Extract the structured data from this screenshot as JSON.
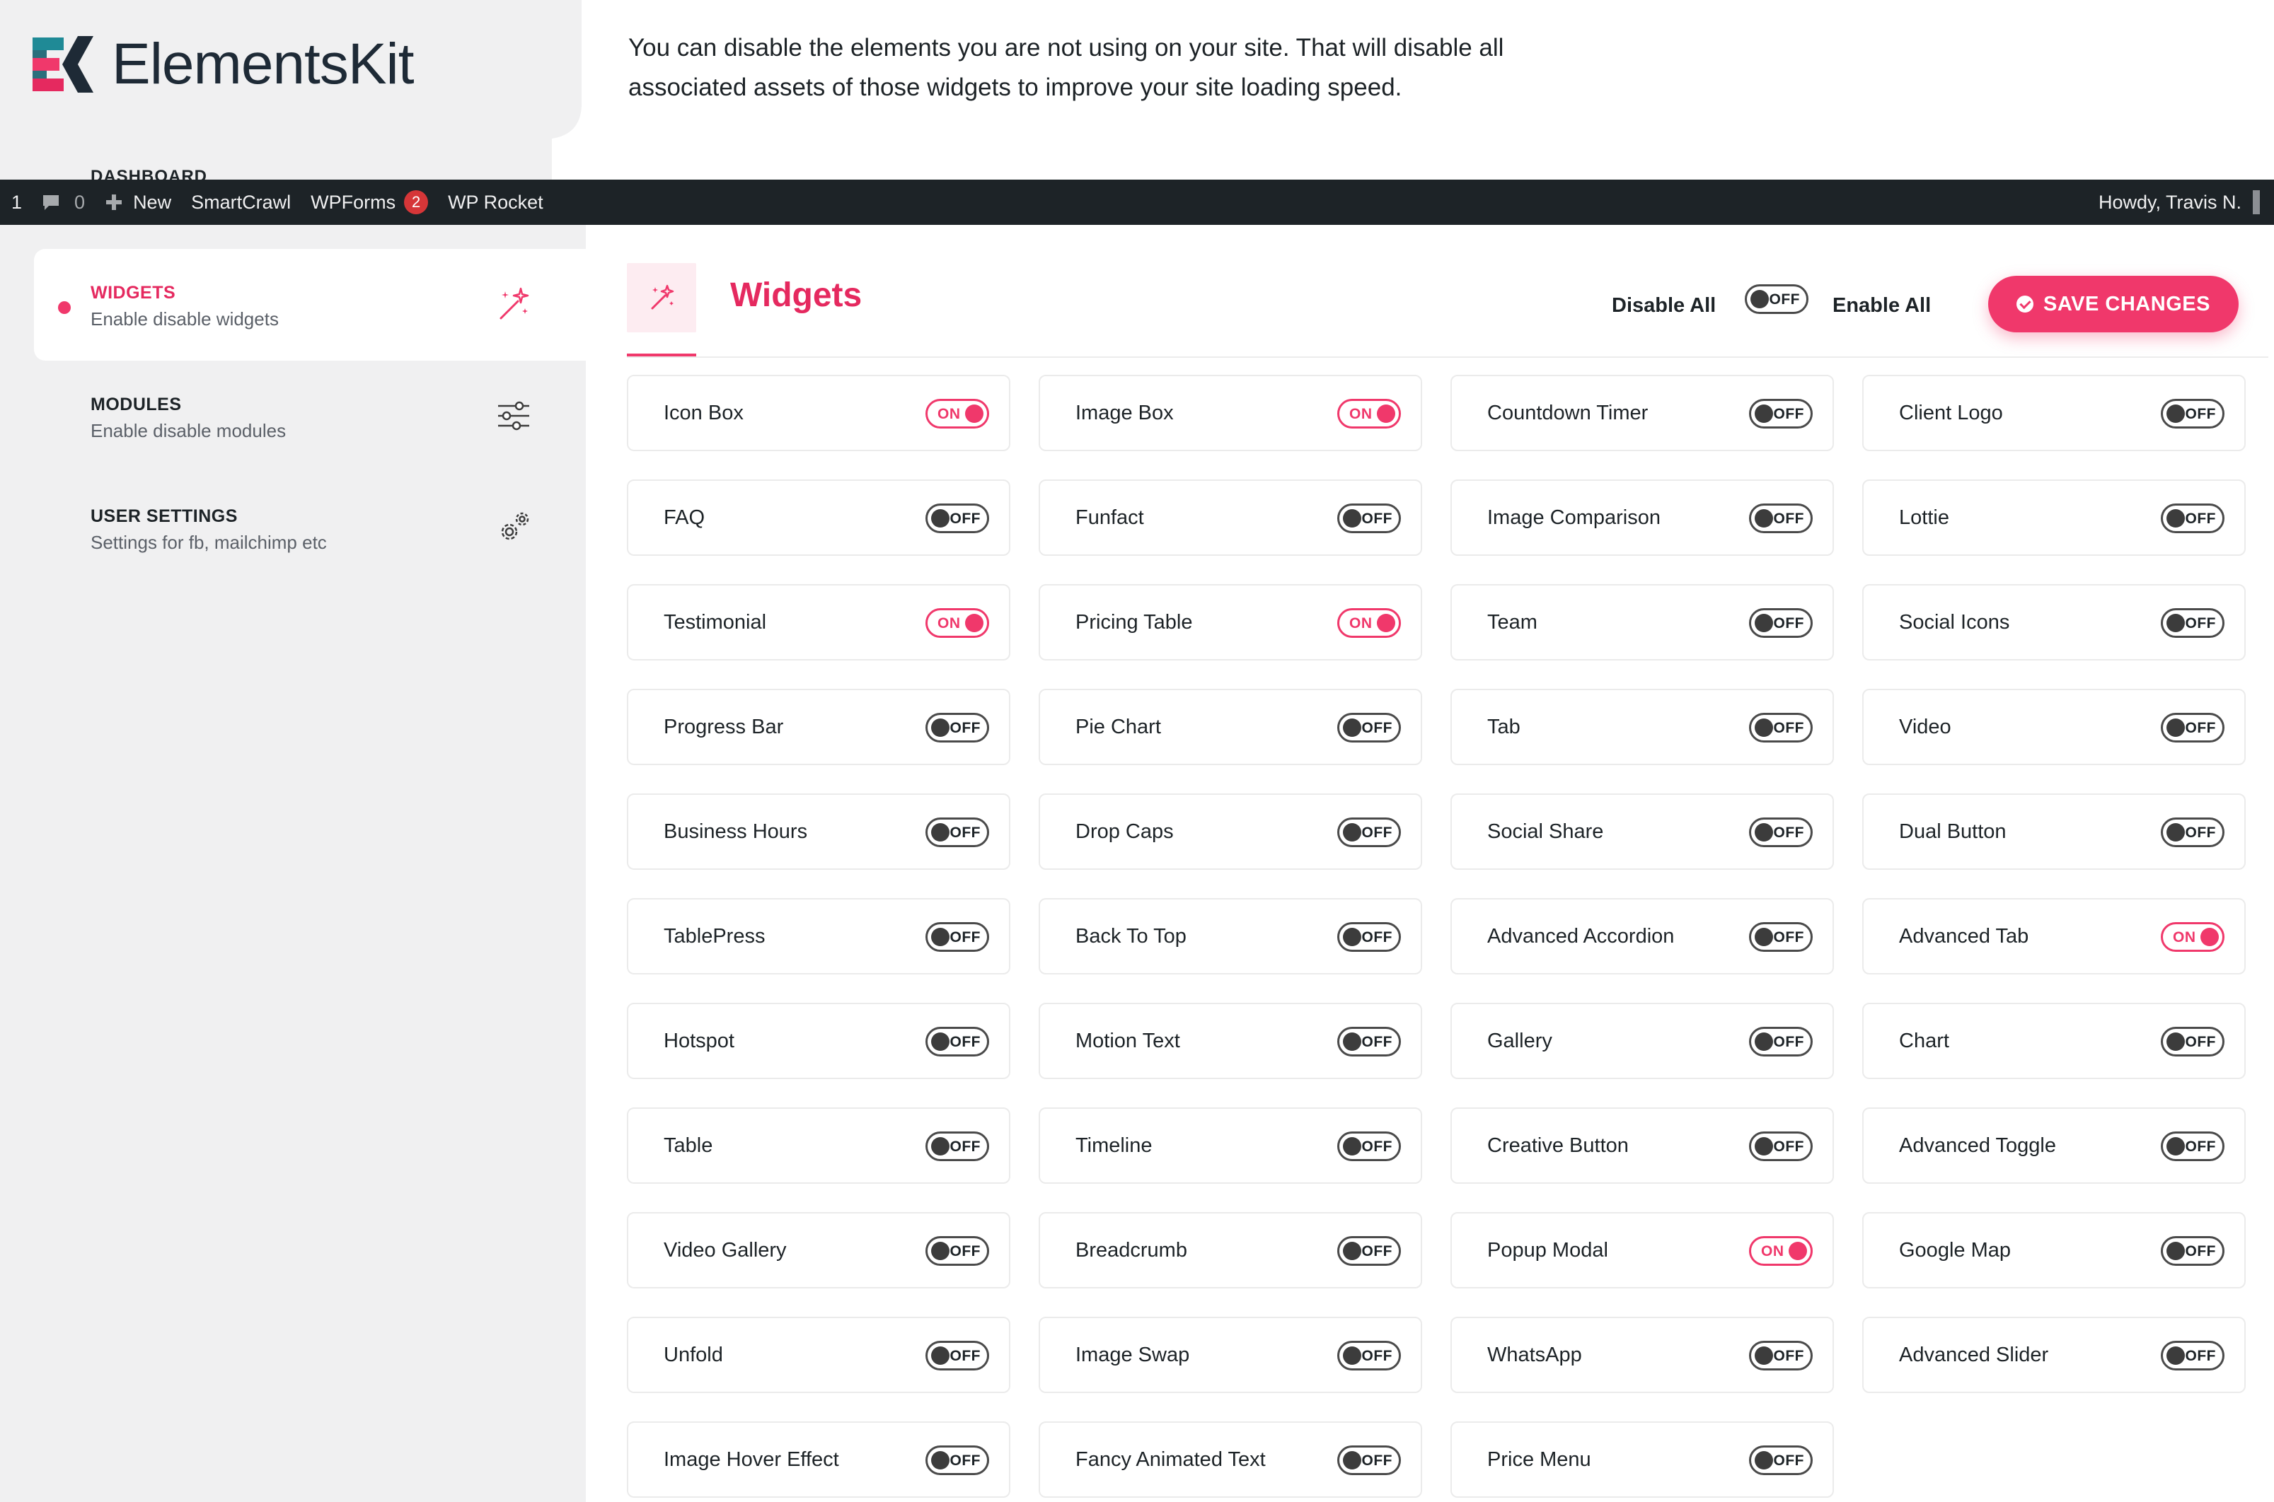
{
  "brand": {
    "name": "ElementsKit",
    "accent": "#f0386b"
  },
  "intro": "You can disable the elements you are not using on your site. That will disable all associated assets of those widgets to improve your site loading speed.",
  "sidebar_partial_label": "DASHBOARD",
  "adminbar": {
    "updates": "1",
    "comments": "0",
    "new": "New",
    "smartcrawl": "SmartCrawl",
    "wpforms": "WPForms",
    "wpforms_badge": "2",
    "wprocket": "WP Rocket",
    "howdy": "Howdy, Travis N."
  },
  "nav": [
    {
      "title": "WIDGETS",
      "sub": "Enable disable widgets",
      "icon": "magic-wand-icon",
      "active": true
    },
    {
      "title": "MODULES",
      "sub": "Enable disable modules",
      "icon": "sliders-icon",
      "active": false
    },
    {
      "title": "USER SETTINGS",
      "sub": "Settings for fb, mailchimp etc",
      "icon": "gears-icon",
      "active": false
    }
  ],
  "header": {
    "title": "Widgets",
    "disable_all": "Disable All",
    "enable_all": "Enable All",
    "master_toggle": "OFF",
    "save": "SAVE CHANGES"
  },
  "toggle_labels": {
    "on": "ON",
    "off": "OFF"
  },
  "widgets": [
    {
      "name": "Icon Box",
      "on": true
    },
    {
      "name": "Image Box",
      "on": true
    },
    {
      "name": "Countdown Timer",
      "on": false
    },
    {
      "name": "Client Logo",
      "on": false
    },
    {
      "name": "FAQ",
      "on": false
    },
    {
      "name": "Funfact",
      "on": false
    },
    {
      "name": "Image Comparison",
      "on": false
    },
    {
      "name": "Lottie",
      "on": false
    },
    {
      "name": "Testimonial",
      "on": true
    },
    {
      "name": "Pricing Table",
      "on": true
    },
    {
      "name": "Team",
      "on": false
    },
    {
      "name": "Social Icons",
      "on": false
    },
    {
      "name": "Progress Bar",
      "on": false
    },
    {
      "name": "Pie Chart",
      "on": false
    },
    {
      "name": "Tab",
      "on": false
    },
    {
      "name": "Video",
      "on": false
    },
    {
      "name": "Business Hours",
      "on": false
    },
    {
      "name": "Drop Caps",
      "on": false
    },
    {
      "name": "Social Share",
      "on": false
    },
    {
      "name": "Dual Button",
      "on": false
    },
    {
      "name": "TablePress",
      "on": false
    },
    {
      "name": "Back To Top",
      "on": false
    },
    {
      "name": "Advanced Accordion",
      "on": false
    },
    {
      "name": "Advanced Tab",
      "on": true
    },
    {
      "name": "Hotspot",
      "on": false
    },
    {
      "name": "Motion Text",
      "on": false
    },
    {
      "name": "Gallery",
      "on": false
    },
    {
      "name": "Chart",
      "on": false
    },
    {
      "name": "Table",
      "on": false
    },
    {
      "name": "Timeline",
      "on": false
    },
    {
      "name": "Creative Button",
      "on": false
    },
    {
      "name": "Advanced Toggle",
      "on": false
    },
    {
      "name": "Video Gallery",
      "on": false
    },
    {
      "name": "Breadcrumb",
      "on": false
    },
    {
      "name": "Popup Modal",
      "on": true
    },
    {
      "name": "Google Map",
      "on": false
    },
    {
      "name": "Unfold",
      "on": false
    },
    {
      "name": "Image Swap",
      "on": false
    },
    {
      "name": "WhatsApp",
      "on": false
    },
    {
      "name": "Advanced Slider",
      "on": false
    },
    {
      "name": "Image Hover Effect",
      "on": false
    },
    {
      "name": "Fancy Animated Text",
      "on": false
    },
    {
      "name": "Price Menu",
      "on": false
    }
  ]
}
